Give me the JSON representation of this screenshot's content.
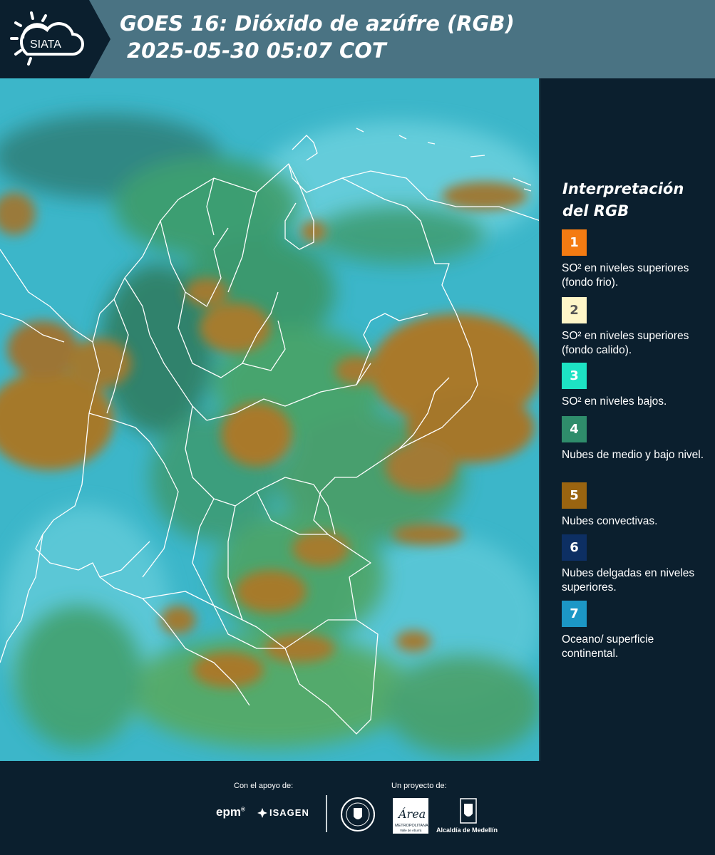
{
  "header": {
    "logo_text": "SIATA",
    "title_line1": "GOES 16: Dióxido de azúfre (RGB)",
    "title_line2": "2025-05-30 05:07 COT"
  },
  "legend": {
    "title_line1": "Interpretación",
    "title_line2": "del RGB",
    "items": [
      {
        "number": "1",
        "color": "#f47b12",
        "text": "SO² en niveles superiores (fondo frio)."
      },
      {
        "number": "2",
        "color": "#fef6c8",
        "text": "SO² en niveles superiores (fondo calido)."
      },
      {
        "number": "3",
        "color": "#1de3c4",
        "text": "SO² en niveles bajos."
      },
      {
        "number": "4",
        "color": "#2f8d6b",
        "text": "Nubes de medio y bajo nivel."
      },
      {
        "number": "5",
        "color": "#9a6410",
        "text": "Nubes convectivas."
      },
      {
        "number": "6",
        "color": "#0d2f63",
        "text": "Nubes delgadas en niveles superiores."
      },
      {
        "number": "7",
        "color": "#1c97c6",
        "text": "Oceano/ superficie continental."
      }
    ]
  },
  "footer": {
    "support_label": "Con el apoyo de:",
    "project_label": "Un proyecto de:",
    "sponsor_epm": "epm",
    "sponsor_isagen": "ISAGEN",
    "area_metropolitana": "Área",
    "area_caption": "METROPOLITANA",
    "area_subcaption": "Valle de Aburrá",
    "alcaldia": "Alcaldía de Medellín"
  },
  "map": {
    "ocean_color": "#3cb6c9",
    "vegetation_color": "#3f9f63",
    "convective_color": "#a5792c",
    "border_color": "#ffffff"
  }
}
